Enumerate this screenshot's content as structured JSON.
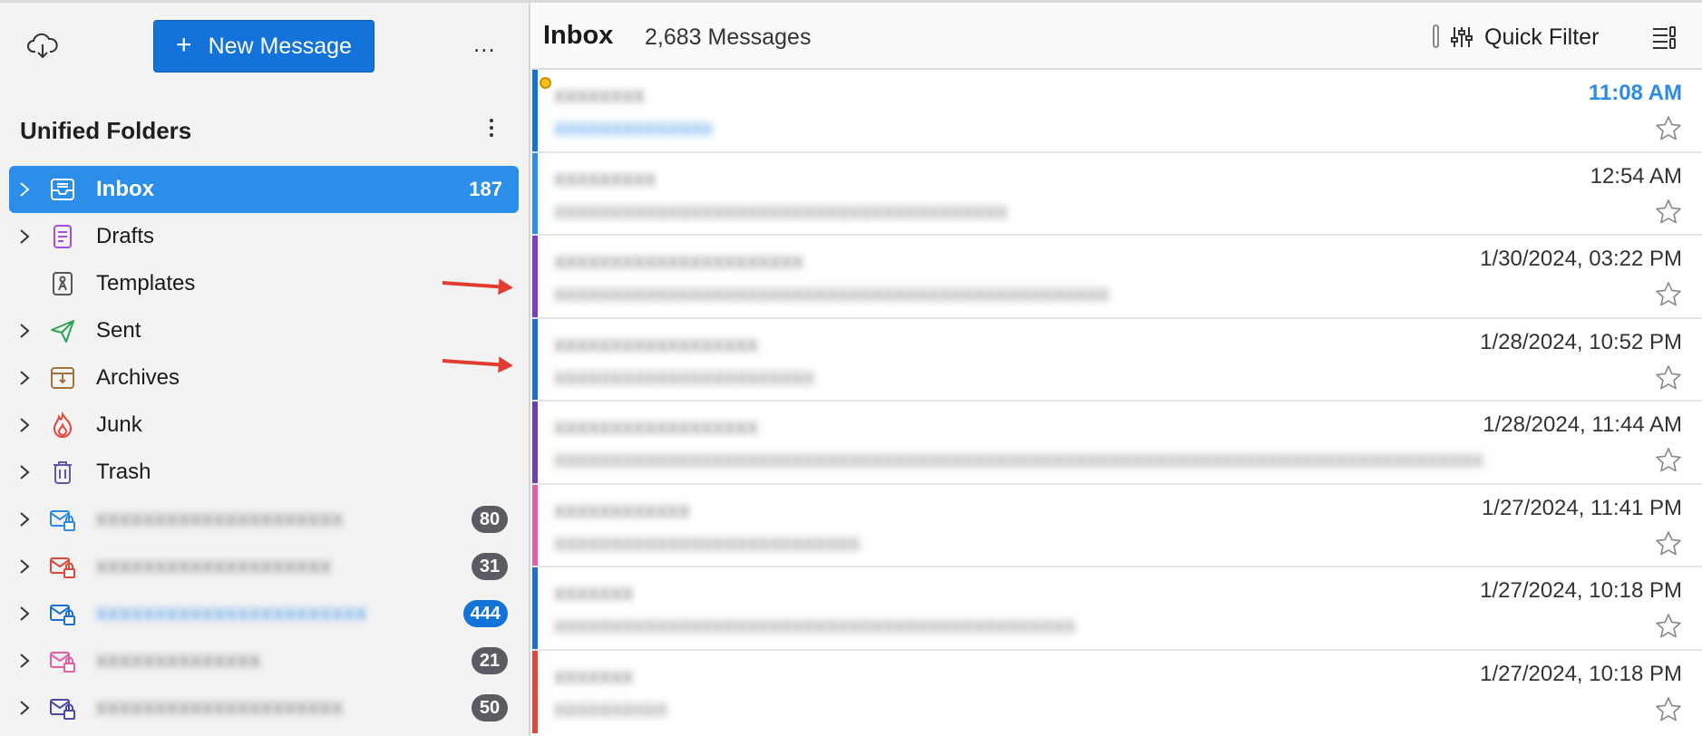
{
  "toolbar": {
    "new_message_label": "New Message",
    "more_label": "..."
  },
  "sidebar": {
    "title": "Unified Folders",
    "folders": [
      {
        "name": "Inbox",
        "count": "187",
        "icon": "inbox-icon",
        "icon_color": "#ffffff",
        "selected": true
      },
      {
        "name": "Drafts",
        "icon": "drafts-icon",
        "icon_color": "#a34fe0"
      },
      {
        "name": "Templates",
        "icon": "templates-icon",
        "icon_color": "#555555"
      },
      {
        "name": "Sent",
        "icon": "sent-icon",
        "icon_color": "#2aa452"
      },
      {
        "name": "Archives",
        "icon": "archives-icon",
        "icon_color": "#a0723c"
      },
      {
        "name": "Junk",
        "icon": "junk-icon",
        "icon_color": "#e0463a"
      },
      {
        "name": "Trash",
        "icon": "trash-icon",
        "icon_color": "#5e5aa8"
      }
    ],
    "accounts": [
      {
        "name": "xxxxxxxxxxxxxxxxxxxxx",
        "count": "80",
        "icon_color": "#2d8be6"
      },
      {
        "name": "xxxxxxxxxxxxxxxxxxxx",
        "count": "31",
        "icon_color": "#e0463a"
      },
      {
        "name": "xxxxxxxxxxxxxxxxxxxxxxx",
        "count": "444",
        "icon_color": "#1a6fcf",
        "highlight": true
      },
      {
        "name": "xxxxxxxxxxxxxx",
        "count": "21",
        "icon_color": "#e85ca5"
      },
      {
        "name": "xxxxxxxxxxxxxxxxxxxxx",
        "count": "50",
        "icon_color": "#4b4aa6"
      }
    ]
  },
  "main": {
    "title": "Inbox",
    "message_count": "2,683 Messages",
    "quick_filter_label": "Quick Filter",
    "messages": [
      {
        "sender": "xxxxxxxx",
        "subject": "xxxxxxxxxxxxxx",
        "date": "11:08 AM",
        "unread": true,
        "bar_color": "#1373d9"
      },
      {
        "sender": "xxxxxxxxx",
        "subject": "xxxxxxxxxxxxxxxxxxxxxxxxxxxxxxxxxxxxxxxx",
        "date": "12:54 AM",
        "bar_color": "#2b8ee8"
      },
      {
        "sender": "xxxxxxxxxxxxxxxxxxxxxx",
        "subject": "xxxxxxxxxxxxxxxxxxxxxxxxxxxxxxxxxxxxxxxxxxxxxxxxx",
        "date": "1/30/2024, 03:22 PM",
        "bar_color": "#7b3fc4"
      },
      {
        "sender": "xxxxxxxxxxxxxxxxxx",
        "subject": "xxxxxxxxxxxxxxxxxxxxxxx",
        "date": "1/28/2024, 10:52 PM",
        "bar_color": "#1a6fcf"
      },
      {
        "sender": "xxxxxxxxxxxxxxxxxx",
        "subject": "xxxxxxxxxxxxxxxxxxxxxxxxxxxxxxxxxxxxxxxxxxxxxxxxxxxxxxxxxxxxxxxxxxxxxxxxxxxxxxxxxx",
        "date": "1/28/2024, 11:44 AM",
        "bar_color": "#6a3fb8"
      },
      {
        "sender": "xxxxxxxxxxxx",
        "subject": "xxxxxxxxxxxxxxxxxxxxxxxxxxx",
        "date": "1/27/2024, 11:41 PM",
        "bar_color": "#e85ca5"
      },
      {
        "sender": "xxxxxxx",
        "subject": "xxxxxxxxxxxxxxxxxxxxxxxxxxxxxxxxxxxxxxxxxxxxxx",
        "date": "1/27/2024, 10:18 PM",
        "bar_color": "#1a6fcf"
      },
      {
        "sender": "xxxxxxx",
        "subject": "xxxxxxxxxx",
        "date": "1/27/2024, 10:18 PM",
        "bar_color": "#e0463a"
      }
    ]
  }
}
